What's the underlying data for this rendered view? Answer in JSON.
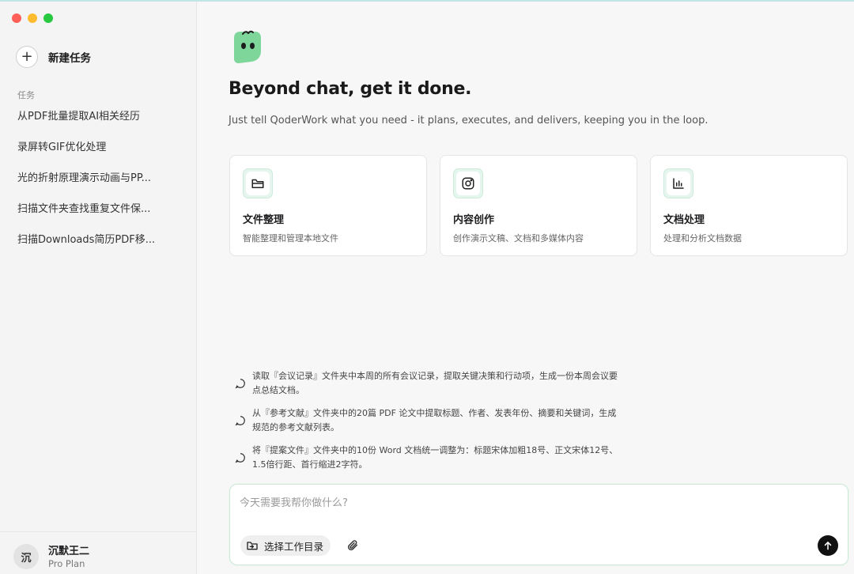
{
  "sidebar": {
    "new_task_label": "新建任务",
    "section_label": "任务",
    "tasks": [
      {
        "label": "从PDF批量提取AI相关经历"
      },
      {
        "label": "录屏转GIF优化处理"
      },
      {
        "label": "光的折射原理演示动画与PP..."
      },
      {
        "label": "扫描文件夹查找重复文件保..."
      },
      {
        "label": "扫描Downloads简历PDF移..."
      }
    ],
    "user": {
      "avatar_text": "沉",
      "name": "沉默王二",
      "plan": "Pro Plan"
    }
  },
  "main": {
    "headline": "Beyond chat, get it done.",
    "subline": "Just tell QoderWork what you need - it plans, executes, and delivers, keeping you in the loop.",
    "cards": [
      {
        "title": "文件整理",
        "desc": "智能整理和管理本地文件",
        "icon": "folder-icon"
      },
      {
        "title": "内容创作",
        "desc": "创作演示文稿、文档和多媒体内容",
        "icon": "instagram-icon"
      },
      {
        "title": "文档处理",
        "desc": "处理和分析文档数据",
        "icon": "bar-chart-icon"
      }
    ],
    "suggestions": [
      {
        "text": "读取『会议记录』文件夹中本周的所有会议记录，提取关键决策和行动项，生成一份本周会议要点总结文档。"
      },
      {
        "text": "从『参考文献』文件夹中的20篇 PDF 论文中提取标题、作者、发表年份、摘要和关键词，生成规范的参考文献列表。"
      },
      {
        "text": "将『提案文件』文件夹中的10份 Word 文档统一调整为：标题宋体加粗18号、正文宋体12号、1.5倍行距、首行缩进2字符。"
      }
    ],
    "composer": {
      "placeholder": "今天需要我帮你做什么?",
      "value": "",
      "workdir_label": "选择工作目录"
    }
  },
  "colors": {
    "accent_green": "#7fd69a",
    "send_button": "#111111",
    "traffic_red": "#ff5f57",
    "traffic_yellow": "#febc2e",
    "traffic_green": "#28c840"
  }
}
